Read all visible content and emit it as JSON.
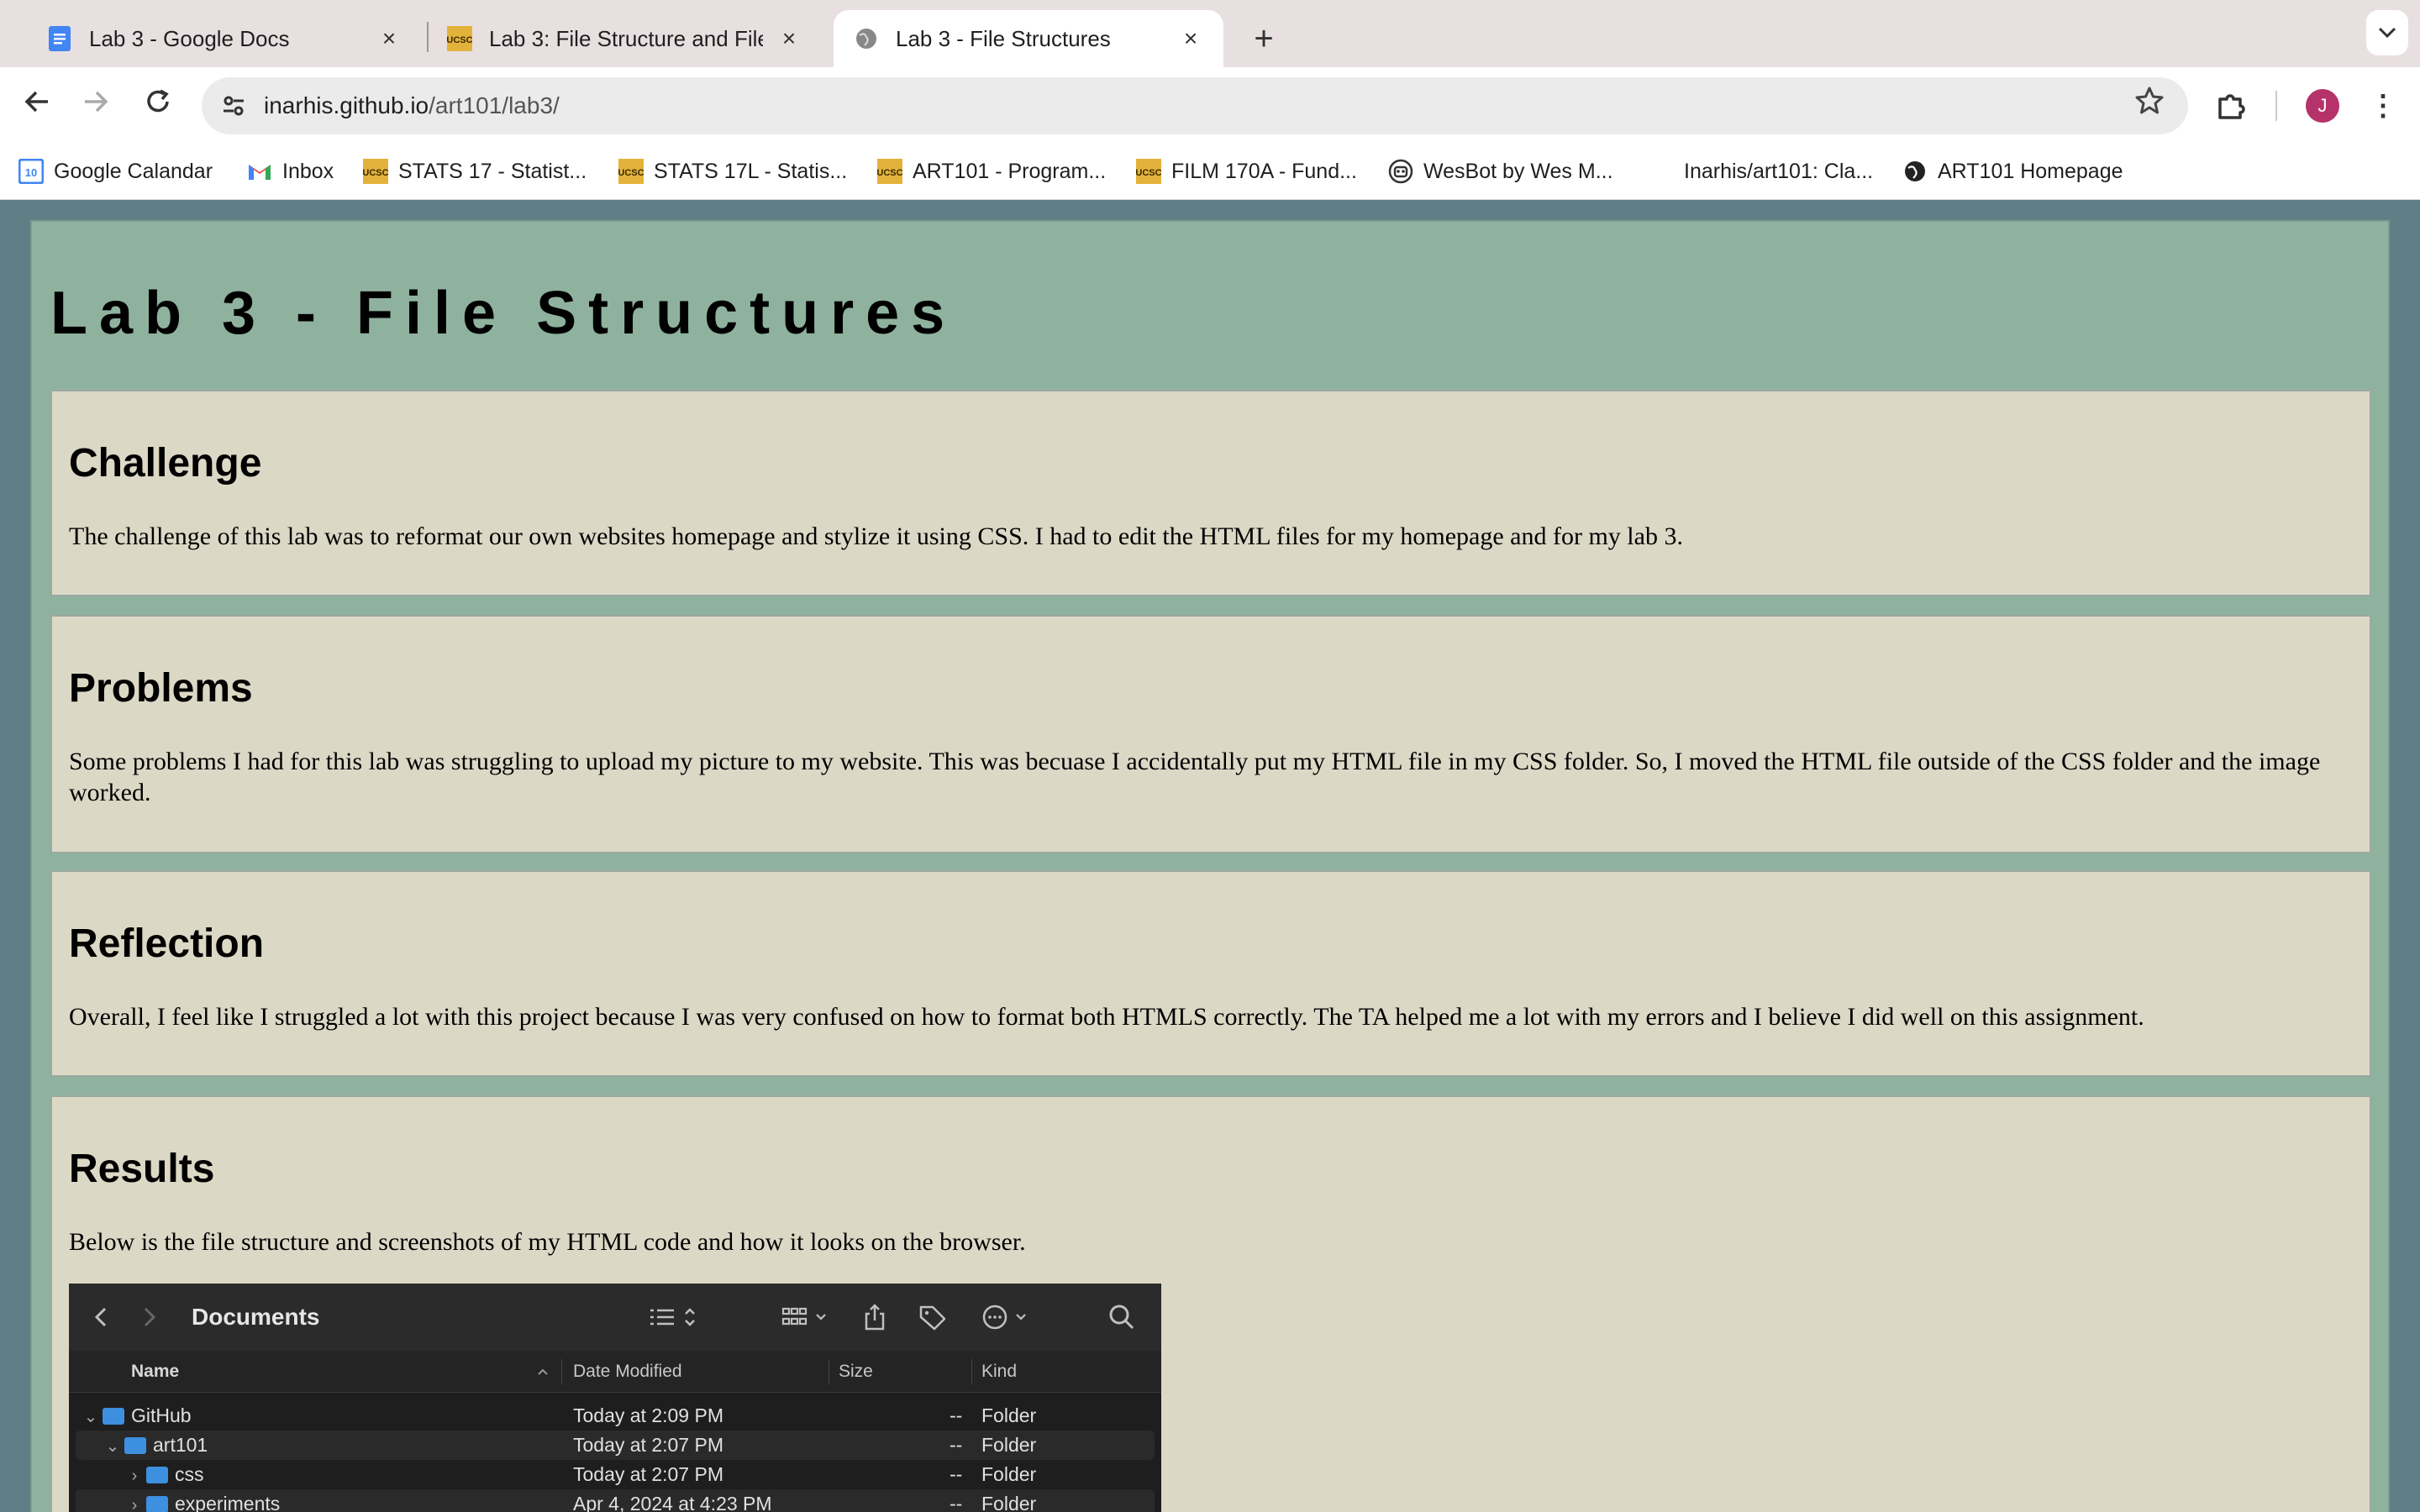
{
  "browser": {
    "tabs": [
      {
        "title": "Lab 3 - Google Docs",
        "icon": "google-docs-icon",
        "active": false
      },
      {
        "title": "Lab 3: File Structure and File",
        "icon": "ucsc-icon",
        "active": false
      },
      {
        "title": "Lab 3 - File Structures",
        "icon": "globe-icon",
        "active": true
      }
    ],
    "close_glyph": "×",
    "new_tab_glyph": "+",
    "url_domain": "inarhis.github.io",
    "url_path": "/art101/lab3/",
    "avatar_letter": "J",
    "bookmarks": [
      {
        "label": "Google Calandar",
        "icon": "google-calendar-icon"
      },
      {
        "label": "Inbox",
        "icon": "gmail-icon"
      },
      {
        "label": "STATS 17 - Statist...",
        "icon": "ucsc-icon"
      },
      {
        "label": "STATS 17L - Statis...",
        "icon": "ucsc-icon"
      },
      {
        "label": "ART101 - Program...",
        "icon": "ucsc-icon"
      },
      {
        "label": "FILM 170A - Fund...",
        "icon": "ucsc-icon"
      },
      {
        "label": "WesBot by Wes M...",
        "icon": "robot-icon"
      },
      {
        "label": "Inarhis/art101: Cla...",
        "icon": "github-icon"
      },
      {
        "label": "ART101 Homepage",
        "icon": "globe-icon"
      }
    ],
    "accent": "#1a73e8"
  },
  "page": {
    "title": "Lab 3 - File Structures",
    "sections": [
      {
        "heading": "Challenge",
        "body": "The challenge of this lab was to reformat our own websites homepage and stylize it using CSS. I had to edit the HTML files for my homepage and for my lab 3."
      },
      {
        "heading": "Problems",
        "body": "Some problems I had for this lab was struggling to upload my picture to my website. This was becuase I accidentally put my HTML file in my CSS folder. So, I moved the HTML file outside of the CSS folder and the image worked."
      },
      {
        "heading": "Reflection",
        "body": "Overall, I feel like I struggled a lot with this project because I was very confused on how to format both HTMLS correctly. The TA helped me a lot with my errors and I believe I did well on this assignment."
      },
      {
        "heading": "Results",
        "body": "Below is the file structure and screenshots of my HTML code and how it looks on the browser."
      }
    ],
    "colors": {
      "background": "#5e7f86",
      "main": "#8fb29f",
      "section": "#dcd8c6"
    }
  },
  "finder": {
    "title": "Documents",
    "columns": {
      "name": "Name",
      "date": "Date Modified",
      "size": "Size",
      "kind": "Kind"
    },
    "rows": [
      {
        "name": "GitHub",
        "date": "Today at 2:09 PM",
        "size": "--",
        "kind": "Folder",
        "expanded": true
      },
      {
        "name": "art101",
        "date": "Today at 2:07 PM",
        "size": "--",
        "kind": "Folder",
        "expanded": true
      },
      {
        "name": "css",
        "date": "Today at 2:07 PM",
        "size": "--",
        "kind": "Folder",
        "expanded": false
      },
      {
        "name": "experiments",
        "date": "Apr 4, 2024 at 4:23 PM",
        "size": "--",
        "kind": "Folder",
        "expanded": false
      }
    ]
  }
}
